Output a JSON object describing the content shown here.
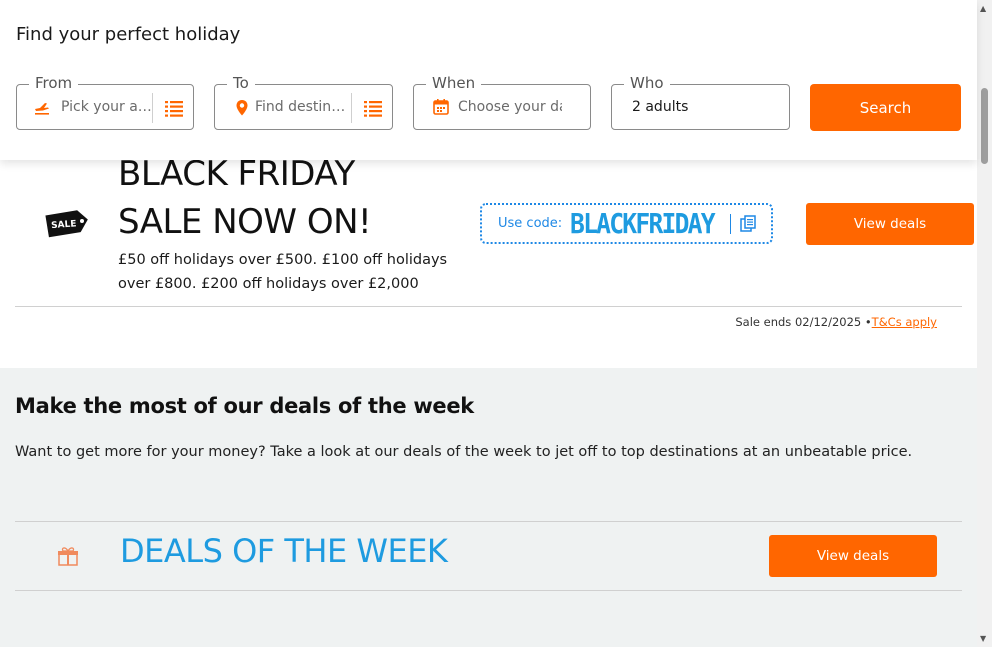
{
  "search": {
    "title": "Find your perfect holiday",
    "from": {
      "label": "From",
      "placeholder": "Pick your air..."
    },
    "to": {
      "label": "To",
      "placeholder": "Find destinati..."
    },
    "when": {
      "label": "When",
      "placeholder": "Choose your da"
    },
    "who": {
      "label": "Who",
      "value": "2 adults"
    },
    "search_button": "Search"
  },
  "black_friday": {
    "tag_text": "SALE",
    "headline_line1": "BLACK FRIDAY",
    "headline_line2": "SALE NOW ON!",
    "description": "£50 off holidays over £500. £100 off holidays over £800. £200 off holidays over £2,000",
    "code_label": "Use code:",
    "code_value": "BLACKFRIDAY",
    "view_deals": "View deals",
    "sale_ends": "Sale ends 02/12/2025 •",
    "tcs_link": "T&Cs apply"
  },
  "deals": {
    "heading": "Make the most of our deals of the week",
    "text": "Want to get more for your money? Take a look at our deals of the week to jet off to top destinations at an unbeatable price.",
    "banner_title": "DEALS OF THE WEEK",
    "view_deals": "View deals"
  },
  "colors": {
    "accent": "#ff6600",
    "code_blue": "#1e9be0",
    "section_bg": "#eff2f2"
  },
  "icons": [
    "plane-icon",
    "list-icon",
    "pin-icon",
    "calendar-icon",
    "sale-tag-icon",
    "copy-icon",
    "gift-icon",
    "chevron-up-icon",
    "chevron-down-icon"
  ]
}
